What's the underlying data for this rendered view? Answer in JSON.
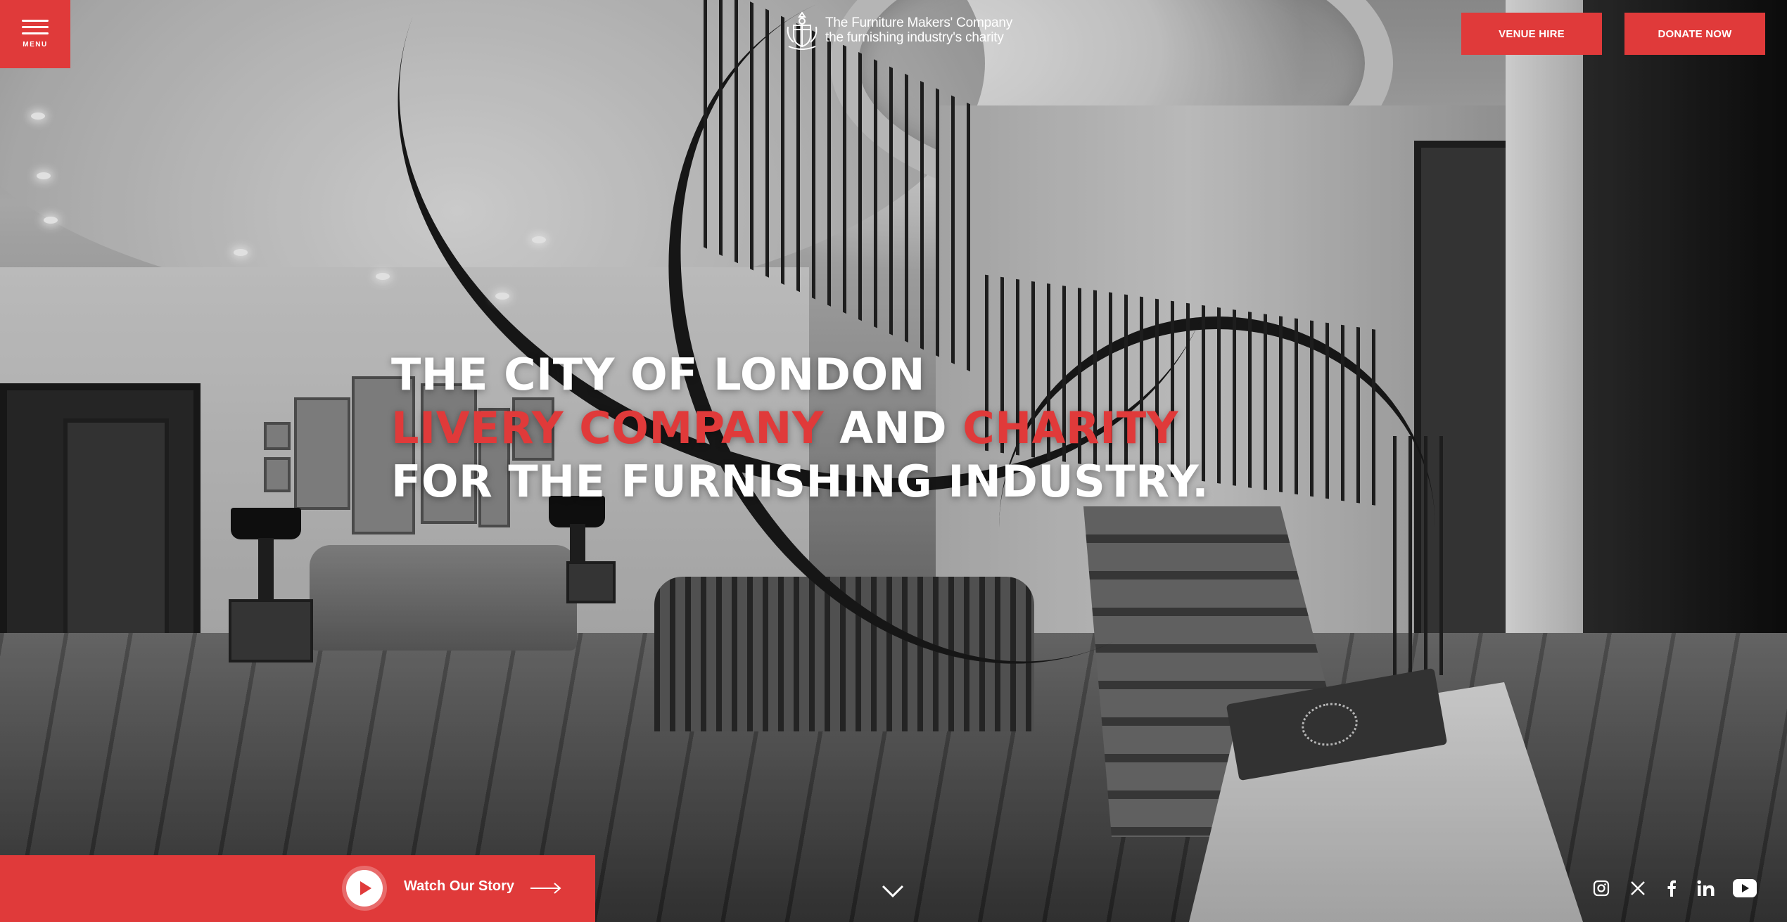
{
  "header": {
    "menu_label": "MENU",
    "logo_line1": "The Furniture Makers' Company",
    "logo_line2": "the furnishing industry's charity",
    "venue_hire_label": "VENUE HIRE",
    "donate_label": "DONATE NOW"
  },
  "hero": {
    "line1": "THE CITY OF LONDON",
    "line2_part1": "LIVERY COMPANY",
    "line2_part2": " AND ",
    "line2_part3": "CHARITY",
    "line3": "FOR THE FURNISHING INDUSTRY."
  },
  "footer_bar": {
    "watch_label": "Watch Our Story"
  },
  "icons": {
    "menu": "hamburger-icon",
    "logo": "crest-icon",
    "play": "play-icon",
    "arrow": "arrow-right-icon",
    "scroll": "chevron-down-icon",
    "socials": [
      "instagram-icon",
      "x-icon",
      "facebook-icon",
      "linkedin-icon",
      "youtube-icon"
    ]
  },
  "colors": {
    "accent": "#e03a3a",
    "text": "#ffffff"
  }
}
